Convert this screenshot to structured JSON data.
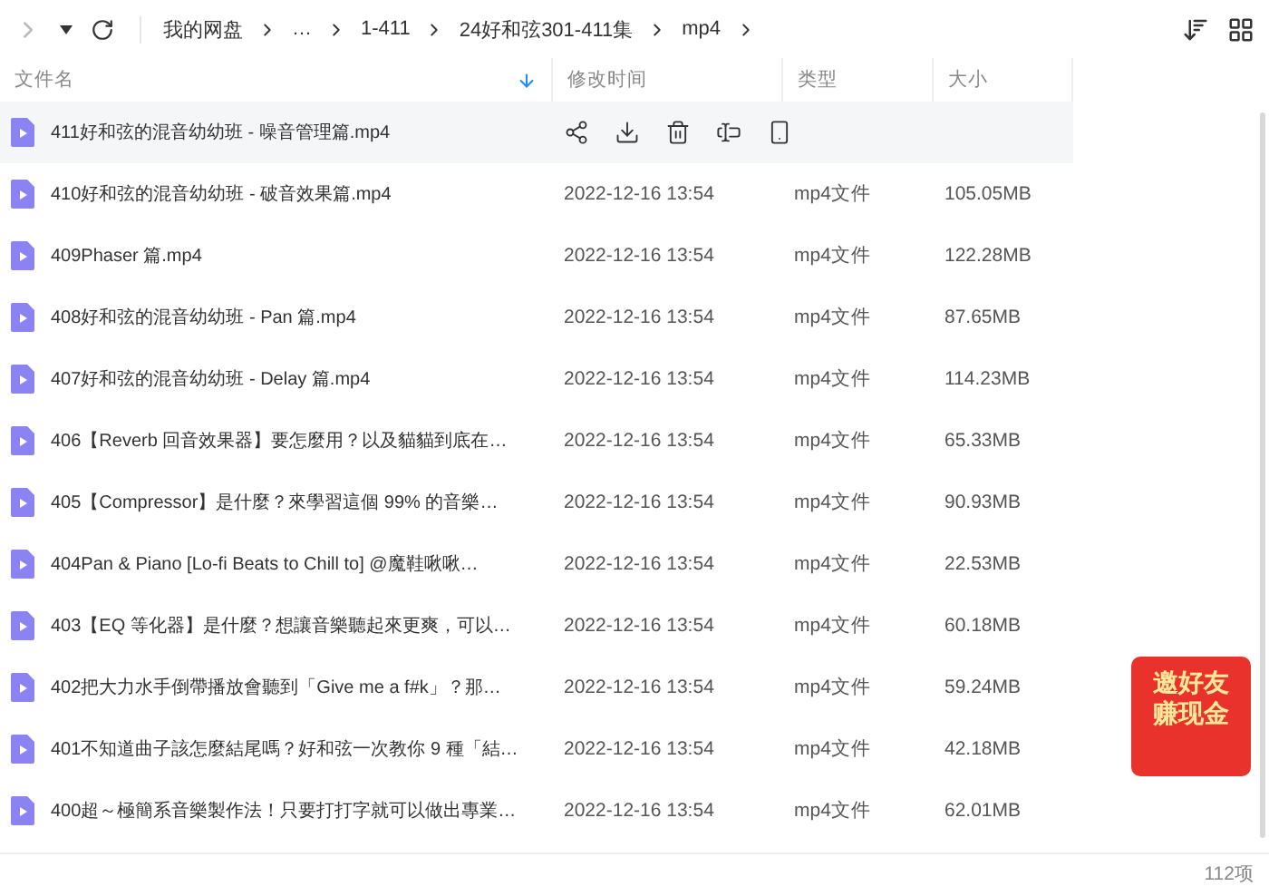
{
  "toolbar": {
    "breadcrumb": [
      "我的网盘",
      "…",
      "1-411",
      "24好和弦301-411集",
      "mp4"
    ]
  },
  "table": {
    "columns": [
      {
        "label": "文件名",
        "sorted": true
      },
      {
        "label": "修改时间",
        "sorted": false
      },
      {
        "label": "类型",
        "sorted": false
      },
      {
        "label": "大小",
        "sorted": false
      }
    ],
    "rows": [
      {
        "name": "411好和弦的混音幼幼班 - 噪音管理篇.mp4",
        "hovered": true
      },
      {
        "name": "410好和弦的混音幼幼班 - 破音效果篇.mp4",
        "hovered": false,
        "modified": "2022-12-16 13:54",
        "type": "mp4文件",
        "size": "105.05MB"
      },
      {
        "name": "409Phaser 篇.mp4",
        "hovered": false,
        "modified": "2022-12-16 13:54",
        "type": "mp4文件",
        "size": "122.28MB"
      },
      {
        "name": "408好和弦的混音幼幼班 - Pan 篇.mp4",
        "hovered": false,
        "modified": "2022-12-16 13:54",
        "type": "mp4文件",
        "size": "87.65MB"
      },
      {
        "name": "407好和弦的混音幼幼班 - Delay 篇.mp4",
        "hovered": false,
        "modified": "2022-12-16 13:54",
        "type": "mp4文件",
        "size": "114.23MB"
      },
      {
        "name": "406【Reverb 回音效果器】要怎麼用？以及貓貓到底在…",
        "hovered": false,
        "modified": "2022-12-16 13:54",
        "type": "mp4文件",
        "size": "65.33MB"
      },
      {
        "name": "405【Compressor】是什麼？來學習這個 99% 的音樂…",
        "hovered": false,
        "modified": "2022-12-16 13:54",
        "type": "mp4文件",
        "size": "90.93MB"
      },
      {
        "name": "404Pan & Piano [Lo-fi Beats to Chill to] @魔鞋啾啾…",
        "hovered": false,
        "modified": "2022-12-16 13:54",
        "type": "mp4文件",
        "size": "22.53MB"
      },
      {
        "name": "403【EQ 等化器】是什麼？想讓音樂聽起來更爽，可以…",
        "hovered": false,
        "modified": "2022-12-16 13:54",
        "type": "mp4文件",
        "size": "60.18MB"
      },
      {
        "name": "402把大力水手倒帶播放會聽到「Give me a f#k」？那…",
        "hovered": false,
        "modified": "2022-12-16 13:54",
        "type": "mp4文件",
        "size": "59.24MB"
      },
      {
        "name": "401不知道曲子該怎麼結尾嗎？好和弦一次教你 9 種「結…",
        "hovered": false,
        "modified": "2022-12-16 13:54",
        "type": "mp4文件",
        "size": "42.18MB"
      },
      {
        "name": "400超～極簡系音樂製作法！只要打打字就可以做出專業…",
        "hovered": false,
        "modified": "2022-12-16 13:54",
        "type": "mp4文件",
        "size": "62.01MB"
      }
    ]
  },
  "promo": {
    "lines": [
      "邀好友",
      "赚现金"
    ]
  },
  "status_bar": {
    "count": "112项"
  }
}
